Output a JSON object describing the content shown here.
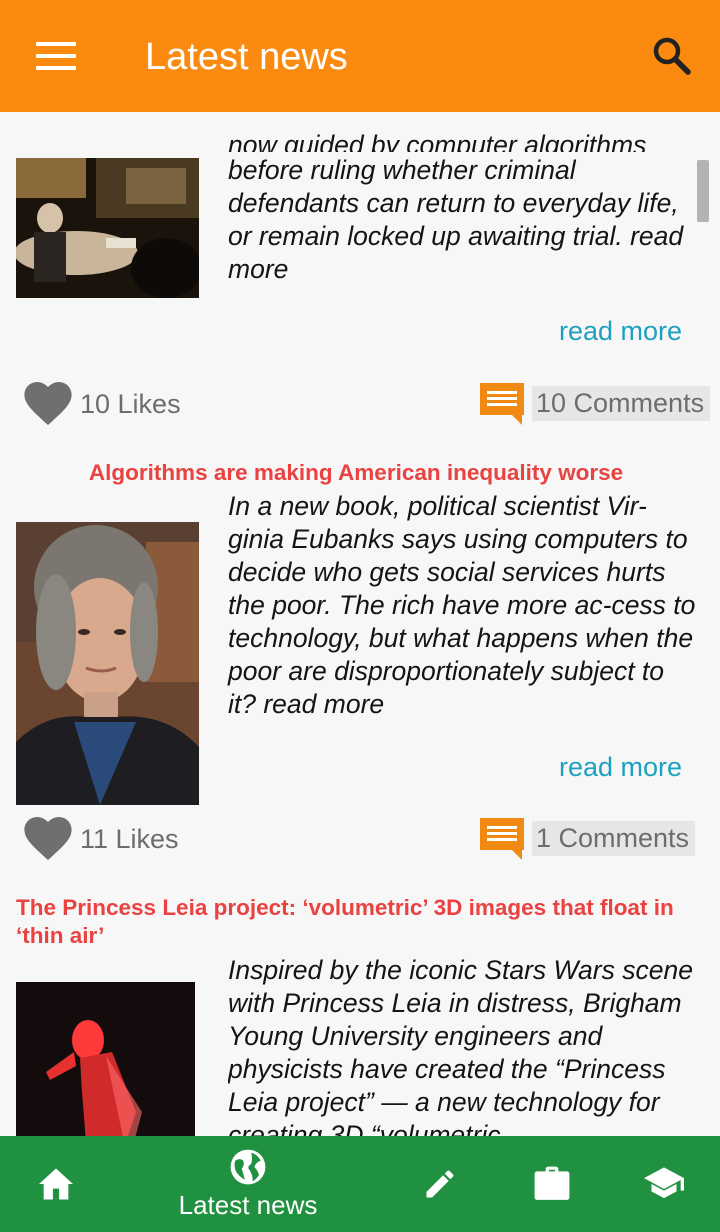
{
  "app_bar": {
    "title": "Latest news"
  },
  "articles": [
    {
      "excerpt_top_line": "now guided by computer algorithms",
      "excerpt": "before ruling whether criminal defendants can return to everyday life, or remain locked up awaiting trial. read more",
      "read_more": "read more",
      "likes": "10 Likes",
      "comments": "10 Comments"
    },
    {
      "title": "Algorithms are making American inequality worse",
      "excerpt": "In a new book, political scientist Vir-ginia Eubanks says using computers to decide who gets social services hurts the poor. The rich have more ac-cess to technology, but what happens when the poor are disproportionately subject to it? read more",
      "read_more": "read more",
      "likes": "11 Likes",
      "comments": "1 Comments"
    },
    {
      "title": "The Princess Leia project: ‘volumetric’ 3D images that float in ‘thin air’",
      "excerpt": "Inspired by the iconic Stars Wars scene with Princess Leia in distress, Brigham Young University engineers and physicists have created the “Princess Leia project” — a new technology for creating 3D “volumetric"
    }
  ],
  "bottom_nav": {
    "active_label": "Latest news",
    "items": [
      "home-icon",
      "globe-icon",
      "pencil-icon",
      "briefcase-icon",
      "school-icon"
    ]
  },
  "colors": {
    "app_bar": "#fb8a10",
    "bottom_nav": "#1f9140",
    "headline": "#ea4141",
    "link": "#1ea1c0",
    "comment_icon": "#f18a13",
    "heart": "#6f6f6f"
  }
}
